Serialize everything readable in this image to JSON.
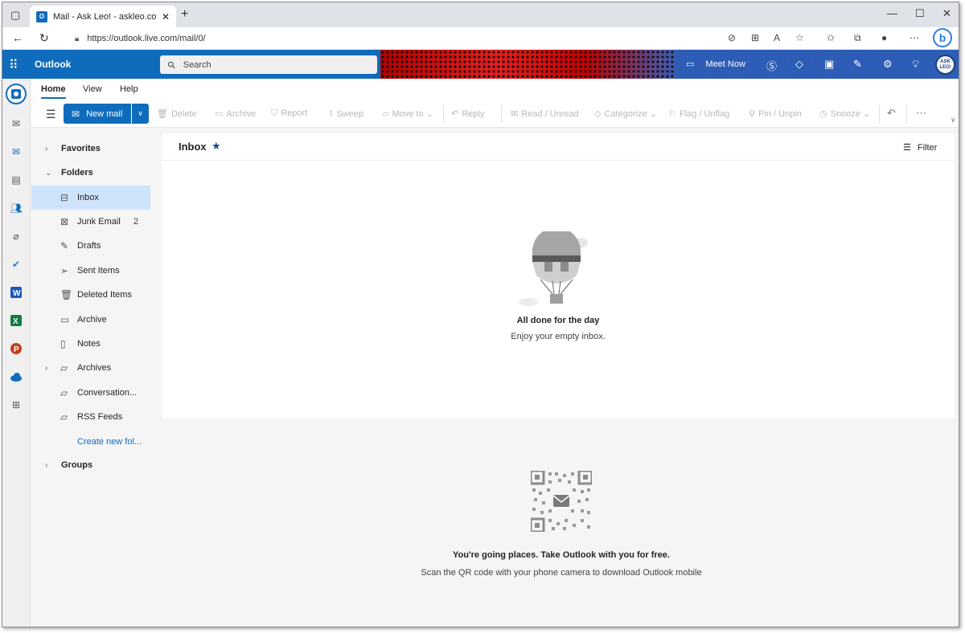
{
  "browser": {
    "tab_title": "Mail - Ask Leo! - askleo.com - O…",
    "tab_favicon": "O",
    "url": "https://outlook.live.com/mail/0/"
  },
  "header": {
    "app_name": "Outlook",
    "search_placeholder": "Search",
    "meet_now": "Meet Now",
    "avatar_text": "ASK LEO!"
  },
  "ribbon": {
    "tabs": [
      "Home",
      "View",
      "Help"
    ],
    "new_mail": "New mail",
    "commands": [
      "Delete",
      "Archive",
      "Report",
      "Sweep",
      "Move to",
      "Reply",
      "Read / Unread",
      "Categorize",
      "Flag / Unflag",
      "Pin / Unpin",
      "Snooze"
    ]
  },
  "folders": {
    "favorites": "Favorites",
    "folders_header": "Folders",
    "items": [
      {
        "label": "Inbox",
        "count": ""
      },
      {
        "label": "Junk Email",
        "count": "2"
      },
      {
        "label": "Drafts",
        "count": ""
      },
      {
        "label": "Sent Items",
        "count": ""
      },
      {
        "label": "Deleted Items",
        "count": ""
      },
      {
        "label": "Archive",
        "count": ""
      },
      {
        "label": "Notes",
        "count": ""
      },
      {
        "label": "Archives",
        "count": ""
      },
      {
        "label": "Conversation...",
        "count": ""
      },
      {
        "label": "RSS Feeds",
        "count": ""
      }
    ],
    "create_new": "Create new fol...",
    "groups": "Groups"
  },
  "list": {
    "title": "Inbox",
    "filter": "Filter",
    "empty_title": "All done for the day",
    "empty_subtitle": "Enjoy your empty inbox."
  },
  "promo": {
    "title": "You're going places. Take Outlook with you for free.",
    "subtitle": "Scan the QR code with your phone camera to download Outlook mobile"
  },
  "colors": {
    "accent": "#0f6cbd",
    "selected_folder": "#cfe4fa"
  }
}
